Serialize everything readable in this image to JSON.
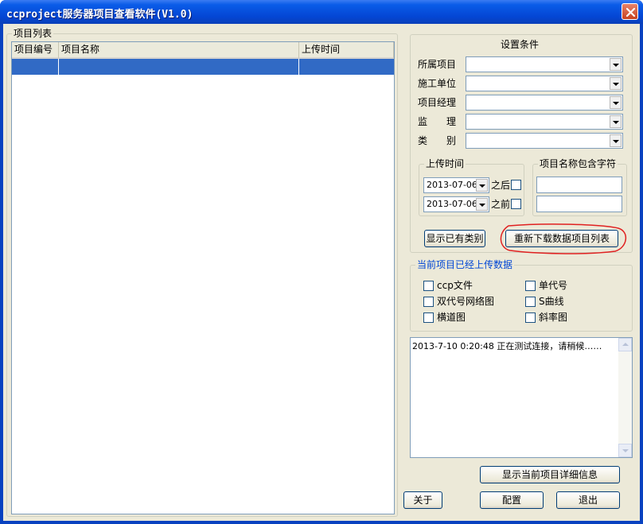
{
  "window": {
    "title": "ccproject服务器项目查看软件(V1.0)"
  },
  "project_list": {
    "group_label": "项目列表",
    "columns": [
      "项目编号",
      "项目名称",
      "上传时间"
    ]
  },
  "conditions": {
    "group_label": "设置条件",
    "fields": [
      {
        "label": "所属项目",
        "value": ""
      },
      {
        "label": "施工单位",
        "value": ""
      },
      {
        "label": "项目经理",
        "value": ""
      },
      {
        "label": "监　　理",
        "value": ""
      },
      {
        "label": "类　　别",
        "value": ""
      }
    ],
    "upload_time": {
      "group_label": "上传时间",
      "after_date": "2013-07-06",
      "after_label": "之后",
      "before_date": "2013-07-06",
      "before_label": "之前"
    },
    "name_contains": {
      "group_label": "项目名称包含字符",
      "value1": "",
      "value2": ""
    },
    "show_categories_button": "显示已有类别",
    "redownload_button": "重新下载数据项目列表",
    "highlight_color": "#e02020"
  },
  "uploaded": {
    "group_label": "当前项目已经上传数据",
    "items": [
      "ccp文件",
      "单代号",
      "双代号网络图",
      "S曲线",
      "横道图",
      "斜率图"
    ]
  },
  "log": {
    "line": "2013-7-10  0:20:48   正在测试连接，请稍候……"
  },
  "buttons": {
    "detail": "显示当前项目详细信息",
    "about": "关于",
    "config": "配置",
    "exit": "退出"
  },
  "colors": {
    "titlebar": "#0a5ce8",
    "selection": "#316ac5",
    "face": "#ece9d8"
  }
}
